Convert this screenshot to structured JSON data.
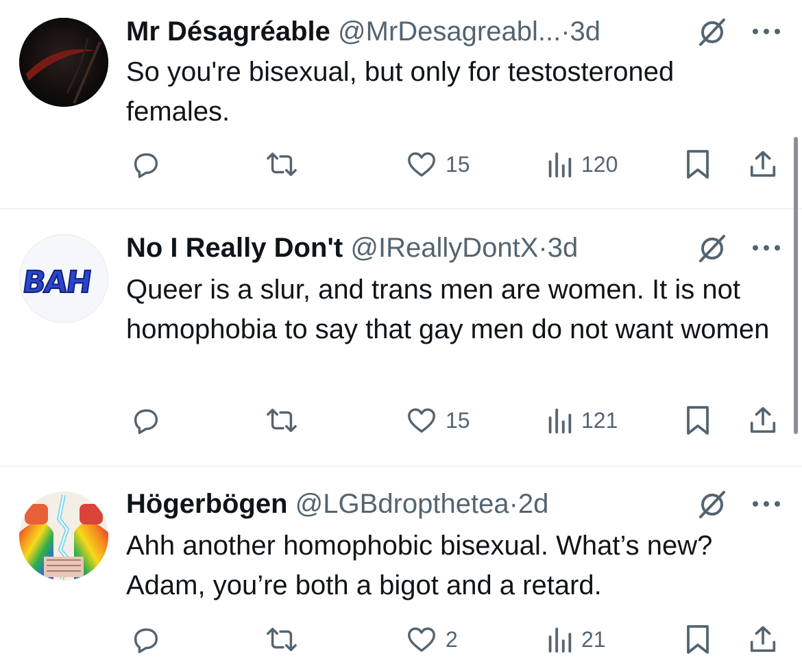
{
  "colors": {
    "text": "#0f1419",
    "secondary": "#536471",
    "divider": "#eff3f4"
  },
  "tweets": [
    {
      "name": "Mr Désagréable",
      "handle": "@MrDesagreabl...",
      "dot": "·",
      "time": "3d",
      "avatar_icon": "reaper-scythe-avatar",
      "text": "So you're bisexual, but only for testosteroned females.",
      "replies": "",
      "reposts": "",
      "likes": "15",
      "views": "120"
    },
    {
      "name": "No I Really Don't",
      "handle": "@IReallyDontX",
      "dot": "·",
      "time": "3d",
      "avatar_icon": "bah-logo-avatar",
      "avatar_text": "BAH",
      "text": "Queer is a slur, and trans men are women. It is not homophobia to say that gay men do not want women",
      "replies": "",
      "reposts": "",
      "likes": "15",
      "views": "121"
    },
    {
      "name": "Högerbögen",
      "handle": "@LGBdropthetea",
      "dot": "·",
      "time": "2d",
      "avatar_icon": "rainbow-fists-avatar",
      "text": "Ahh another homophobic bisexual. What’s new? Adam, you’re both a bigot and a retard.",
      "replies": "",
      "reposts": "",
      "likes": "2",
      "views": "21"
    }
  ]
}
